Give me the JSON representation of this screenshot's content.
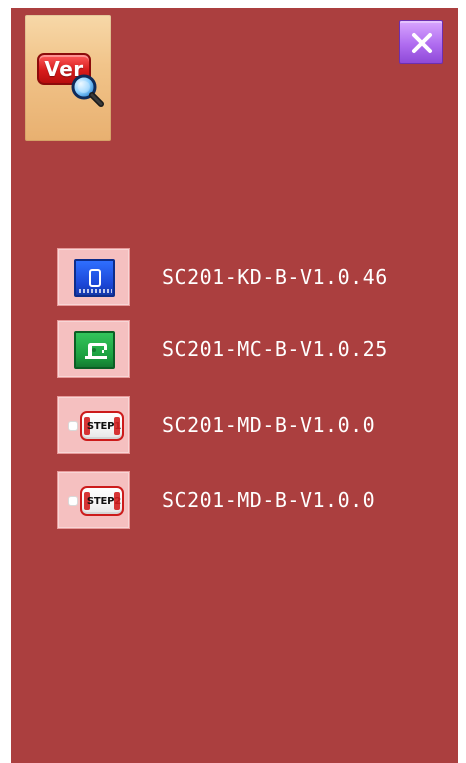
{
  "app": {
    "ver_icon_label": "Ver",
    "close_label": "×"
  },
  "versions": [
    {
      "label": "SC201-KD-B-V1.0.46",
      "icon": "panel-icon"
    },
    {
      "label": "SC201-MC-B-V1.0.25",
      "icon": "main-control-icon"
    },
    {
      "label": "SC201-MD-B-V1.0.0",
      "icon": "step1-motor-icon",
      "step_label": "STEP1"
    },
    {
      "label": "SC201-MD-B-V1.0.0",
      "icon": "step2-motor-icon",
      "step_label": "STEP2"
    }
  ],
  "colors": {
    "background": "#ab3f3f",
    "text": "#ffffff",
    "close_button": "#b06df0",
    "icon_tile": "#f5c0c0"
  }
}
